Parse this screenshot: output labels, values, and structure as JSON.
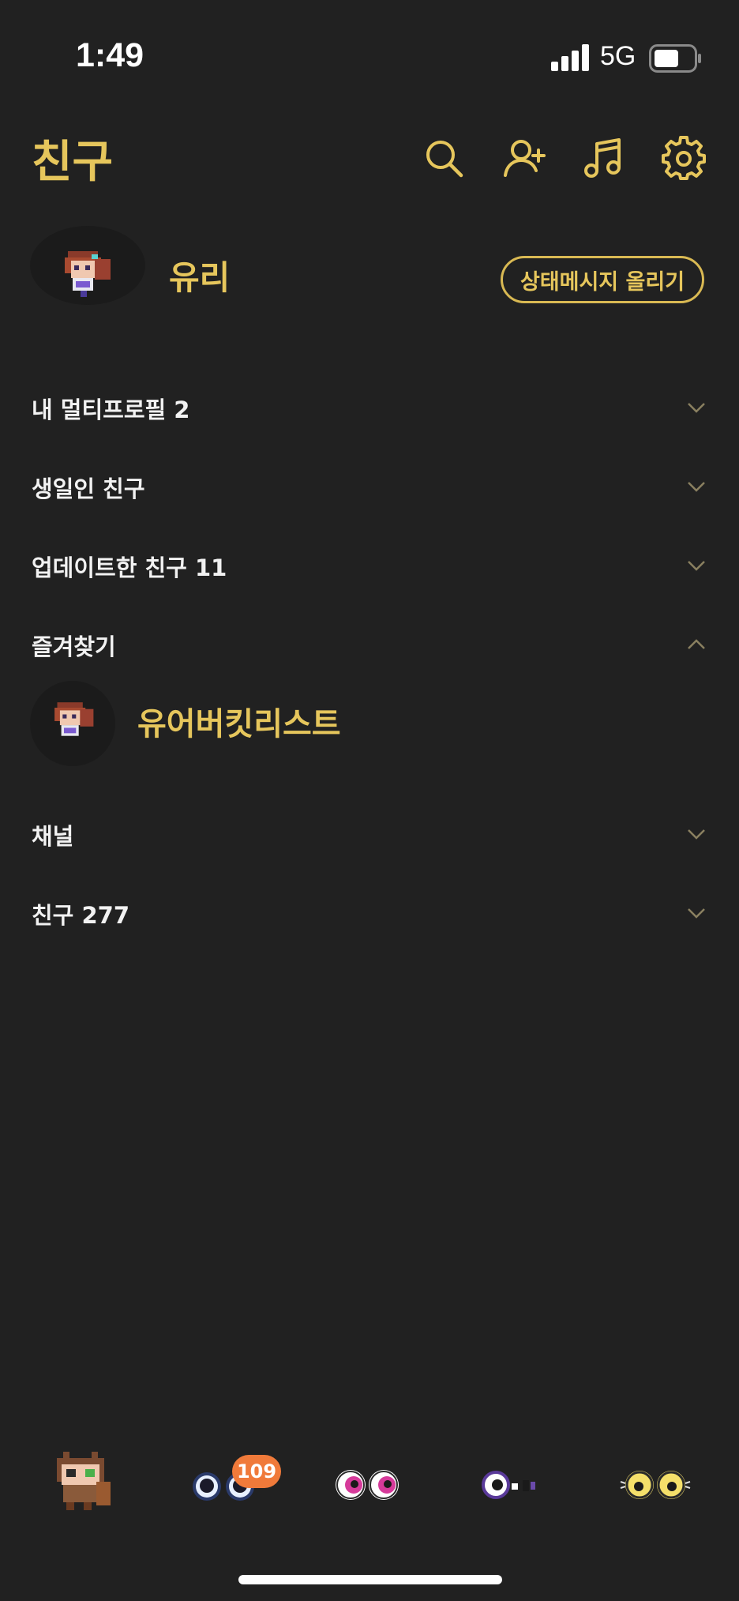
{
  "status_bar": {
    "time": "1:49",
    "network": "5G"
  },
  "header": {
    "title": "친구",
    "icons": [
      "search-icon",
      "add-friend-icon",
      "music-icon",
      "settings-icon"
    ]
  },
  "profile": {
    "name": "유리",
    "status_button": "상태메시지 올리기"
  },
  "sections": [
    {
      "label": "내 멀티프로필 2",
      "expanded": false
    },
    {
      "label": "생일인 친구",
      "expanded": false
    },
    {
      "label": "업데이트한 친구 11",
      "expanded": false
    },
    {
      "label": "즐겨찾기",
      "expanded": true
    },
    {
      "label": "채널",
      "expanded": false
    },
    {
      "label": "친구 277",
      "expanded": false
    }
  ],
  "favorites": [
    {
      "name": "유어버킷리스트"
    }
  ],
  "tab_bar": {
    "chat_badge": "109"
  },
  "colors": {
    "background": "#212121",
    "accent": "#e6c65c",
    "badge": "#f07a3a"
  }
}
